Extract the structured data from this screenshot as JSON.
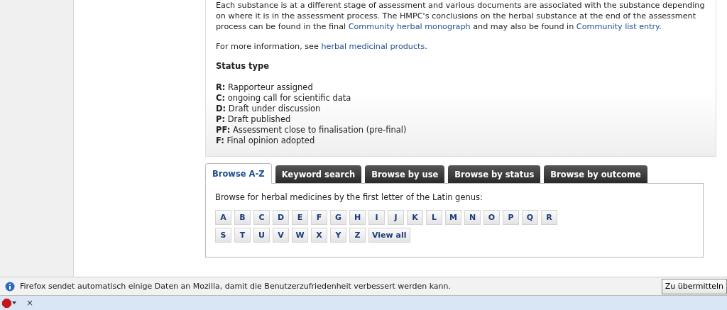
{
  "info_panel": {
    "paragraphs": [
      [
        {
          "text": "Each substance is at a different stage of assessment and various documents are associated with the substance depending on where it is in the assessment process. The HMPC's conclusions on the herbal substance at the end of the assessment process can be found in the final ",
          "kind": "plain"
        },
        {
          "text": "Community herbal monograph",
          "kind": "link"
        },
        {
          "text": " and may also be found in ",
          "kind": "plain"
        },
        {
          "text": "Community list entry",
          "kind": "link"
        },
        {
          "text": ".",
          "kind": "plain"
        }
      ],
      [
        {
          "text": "For more information, see ",
          "kind": "plain"
        },
        {
          "text": "herbal medicinal products",
          "kind": "link"
        },
        {
          "text": ".",
          "kind": "plain"
        }
      ]
    ],
    "status_heading": "Status type",
    "status_types": [
      {
        "code": "R:",
        "label": "Rapporteur assigned"
      },
      {
        "code": "C:",
        "label": "ongoing call for scientific data"
      },
      {
        "code": "D:",
        "label": "Draft under discussion"
      },
      {
        "code": "P:",
        "label": "Draft published"
      },
      {
        "code": "PF:",
        "label": "Assessment close to finalisation (pre-final)"
      },
      {
        "code": "F:",
        "label": "Final opinion adopted"
      }
    ]
  },
  "tabs": [
    {
      "label": "Browse A-Z",
      "selected": true
    },
    {
      "label": "Keyword search",
      "selected": false
    },
    {
      "label": "Browse by use",
      "selected": false
    },
    {
      "label": "Browse by status",
      "selected": false
    },
    {
      "label": "Browse by outcome",
      "selected": false
    }
  ],
  "browse_panel": {
    "intro": "Browse for herbal medicines by the first letter of the Latin genus:",
    "letter_rows": [
      [
        "A",
        "B",
        "C",
        "D",
        "E",
        "F",
        "G",
        "H",
        "I",
        "J",
        "K",
        "L",
        "M",
        "N",
        "O",
        "P",
        "Q",
        "R"
      ],
      [
        "S",
        "T",
        "U",
        "V",
        "W",
        "X",
        "Y",
        "Z",
        "View all"
      ]
    ]
  },
  "notification_bar": {
    "message": "Firefox sendet automatisch einige Daten an Mozilla, damit die Benutzerzufriedenheit verbessert werden kann.",
    "button": "Zu übermitteln"
  },
  "addon_bar": {
    "close": "×"
  }
}
